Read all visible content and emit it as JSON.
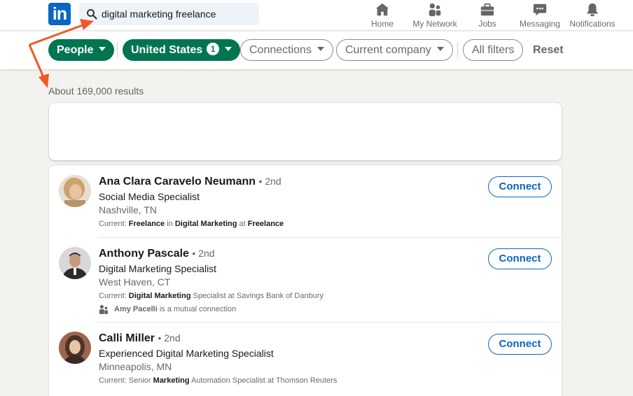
{
  "search": {
    "query": "digital marketing freelance"
  },
  "nav": [
    {
      "label": "Home",
      "icon": "home-icon"
    },
    {
      "label": "My Network",
      "icon": "network-icon"
    },
    {
      "label": "Jobs",
      "icon": "briefcase-icon"
    },
    {
      "label": "Messaging",
      "icon": "messaging-icon"
    },
    {
      "label": "Notifications",
      "icon": "bell-icon"
    }
  ],
  "filters": {
    "people": "People",
    "location": "United States",
    "location_count": "1",
    "connections": "Connections",
    "current_company": "Current company",
    "all_filters": "All filters",
    "reset": "Reset"
  },
  "results_count": "About 169,000 results",
  "results": [
    {
      "name": "Ana Clara Caravelo Neumann",
      "degree": "• 2nd",
      "title": "Social Media Specialist",
      "location": "Nashville, TN",
      "current_parts": [
        "Current: ",
        "Freelance",
        " in ",
        "Digital Marketing",
        " at ",
        "Freelance"
      ],
      "action": "Connect"
    },
    {
      "name": "Anthony Pascale",
      "degree": "• 2nd",
      "title": "Digital Marketing Specialist",
      "location": "West Haven, CT",
      "current_parts": [
        "Current: ",
        "Digital Marketing",
        " Specialist at Savings Bank of Danbury"
      ],
      "mutual_name": "Amy Pacelli",
      "mutual_text": " is a mutual connection",
      "action": "Connect"
    },
    {
      "name": "Calli Miller",
      "degree": "• 2nd",
      "title": "Experienced Digital Marketing Specialist",
      "location": "Minneapolis, MN",
      "current_parts": [
        "Current: Senior ",
        "Marketing",
        " Automation Specialist at Thomson Reuters"
      ],
      "action": "Connect"
    }
  ],
  "colors": {
    "brand": "#0a66c2",
    "filter_green": "#01754f",
    "annotation_arrow": "#f0582a"
  }
}
